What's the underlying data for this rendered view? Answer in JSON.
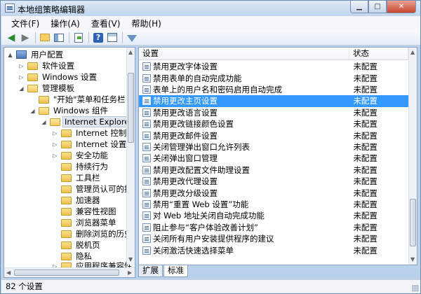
{
  "window": {
    "title": "本地组策略编辑器"
  },
  "menu": [
    "文件(F)",
    "操作(A)",
    "查看(V)",
    "帮助(H)"
  ],
  "tree": {
    "items": [
      {
        "label": "用户配置",
        "icon": "computer-icon",
        "toggle": "▲"
      },
      {
        "label": "软件设置",
        "icon": "folder-icon",
        "toggle": "▷"
      },
      {
        "label": "Windows 设置",
        "icon": "folder-icon",
        "toggle": "▷"
      },
      {
        "label": "管理模板",
        "icon": "folder-icon",
        "toggle": "◢"
      },
      {
        "label": "\"开始\"菜单和任务栏",
        "icon": "folder-icon",
        "toggle": ""
      },
      {
        "label": "Windows 组件",
        "icon": "folder-icon",
        "toggle": "◢"
      },
      {
        "label": "Internet Explorer",
        "icon": "folder-icon",
        "toggle": "◢"
      },
      {
        "label": "Internet 控制面板",
        "icon": "folder-icon",
        "toggle": "▷"
      },
      {
        "label": "Internet 设置",
        "icon": "folder-icon",
        "toggle": "▷"
      },
      {
        "label": "安全功能",
        "icon": "folder-icon",
        "toggle": "▷"
      },
      {
        "label": "持续行为",
        "icon": "folder-icon",
        "toggle": ""
      },
      {
        "label": "工具栏",
        "icon": "folder-icon",
        "toggle": ""
      },
      {
        "label": "管理员认可的控件",
        "icon": "folder-icon",
        "toggle": ""
      },
      {
        "label": "加速器",
        "icon": "folder-icon",
        "toggle": ""
      },
      {
        "label": "兼容性视图",
        "icon": "folder-icon",
        "toggle": ""
      },
      {
        "label": "浏览器菜单",
        "icon": "folder-icon",
        "toggle": ""
      },
      {
        "label": "删除浏览的历史记录",
        "icon": "folder-icon",
        "toggle": ""
      },
      {
        "label": "脱机页",
        "icon": "folder-icon",
        "toggle": ""
      },
      {
        "label": "隐私",
        "icon": "folder-icon",
        "toggle": ""
      },
      {
        "label": "应用程序兼容性",
        "icon": "folder-icon",
        "toggle": "▷"
      }
    ]
  },
  "list": {
    "header_setting": "设置",
    "header_state": "状态",
    "rows": [
      {
        "name": "禁用更改字体设置",
        "state": "未配置"
      },
      {
        "name": "禁用表单的自动完成功能",
        "state": "未配置"
      },
      {
        "name": "表单上的用户名和密码启用自动完成",
        "state": "未配置"
      },
      {
        "name": "禁用更改主页设置",
        "state": "未配置"
      },
      {
        "name": "禁用更改语言设置",
        "state": "未配置"
      },
      {
        "name": "禁用更改链接颜色设置",
        "state": "未配置"
      },
      {
        "name": "禁用更改邮件设置",
        "state": "未配置"
      },
      {
        "name": "关闭管理弹出窗口允许列表",
        "state": "未配置"
      },
      {
        "name": "关闭弹出窗口管理",
        "state": "未配置"
      },
      {
        "name": "禁用更改配置文件助理设置",
        "state": "未配置"
      },
      {
        "name": "禁用更改代理设置",
        "state": "未配置"
      },
      {
        "name": "禁用更改分级设置",
        "state": "未配置"
      },
      {
        "name": "禁用“重置 Web 设置”功能",
        "state": "未配置"
      },
      {
        "name": "对 Web 地址关闭自动完成功能",
        "state": "未配置"
      },
      {
        "name": "阻止参与“客户体验改善计划”",
        "state": "未配置"
      },
      {
        "name": "关闭所有用户安装提供程序的建议",
        "state": "未配置"
      },
      {
        "name": "关闭激活快速选择菜单",
        "state": "未配置"
      }
    ]
  },
  "tabs": [
    "扩展",
    "标准"
  ],
  "status": {
    "text": "82 个设置"
  },
  "colors": {
    "selection": "#3399ff",
    "frame": "#b9d1ea"
  }
}
